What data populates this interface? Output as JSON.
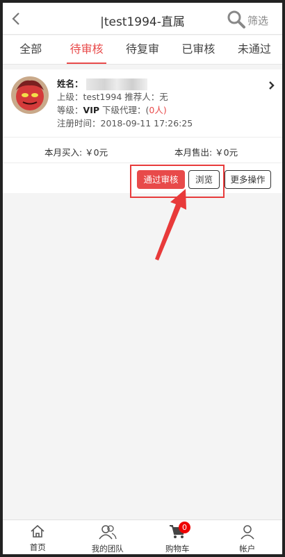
{
  "header": {
    "title": "|test1994-直属",
    "back_icon": "chevron-left-icon",
    "filter_icon": "search-icon",
    "filter_label": "筛选"
  },
  "tabs": [
    {
      "label": "全部",
      "active": false
    },
    {
      "label": "待审核",
      "active": true
    },
    {
      "label": "待复审",
      "active": false
    },
    {
      "label": "已审核",
      "active": false
    },
    {
      "label": "未通过",
      "active": false
    }
  ],
  "member": {
    "name_label": "姓名：",
    "superior_line": "上级：test1994 推荐人：无",
    "level_label": "等级：",
    "level_value": "VIP",
    "sub_agent_label": " 下级代理：(",
    "sub_agent_count": "0",
    "sub_agent_unit": "人)",
    "register_line": "注册时间：2018-09-11 17:26:25",
    "monthly_buy": "本月买入: ￥0元",
    "monthly_sell": "本月售出: ￥0元"
  },
  "actions": {
    "approve_label": "通过审核",
    "browse_label": "浏览",
    "more_label": "更多操作"
  },
  "bottom_nav": [
    {
      "label": "首页",
      "icon": "home-icon"
    },
    {
      "label": "我的团队",
      "icon": "team-icon"
    },
    {
      "label": "购物车",
      "icon": "cart-icon",
      "badge": "0"
    },
    {
      "label": "帐户",
      "icon": "account-icon"
    }
  ],
  "colors": {
    "accent": "#e84a4a",
    "annotation": "#e83a3a"
  }
}
